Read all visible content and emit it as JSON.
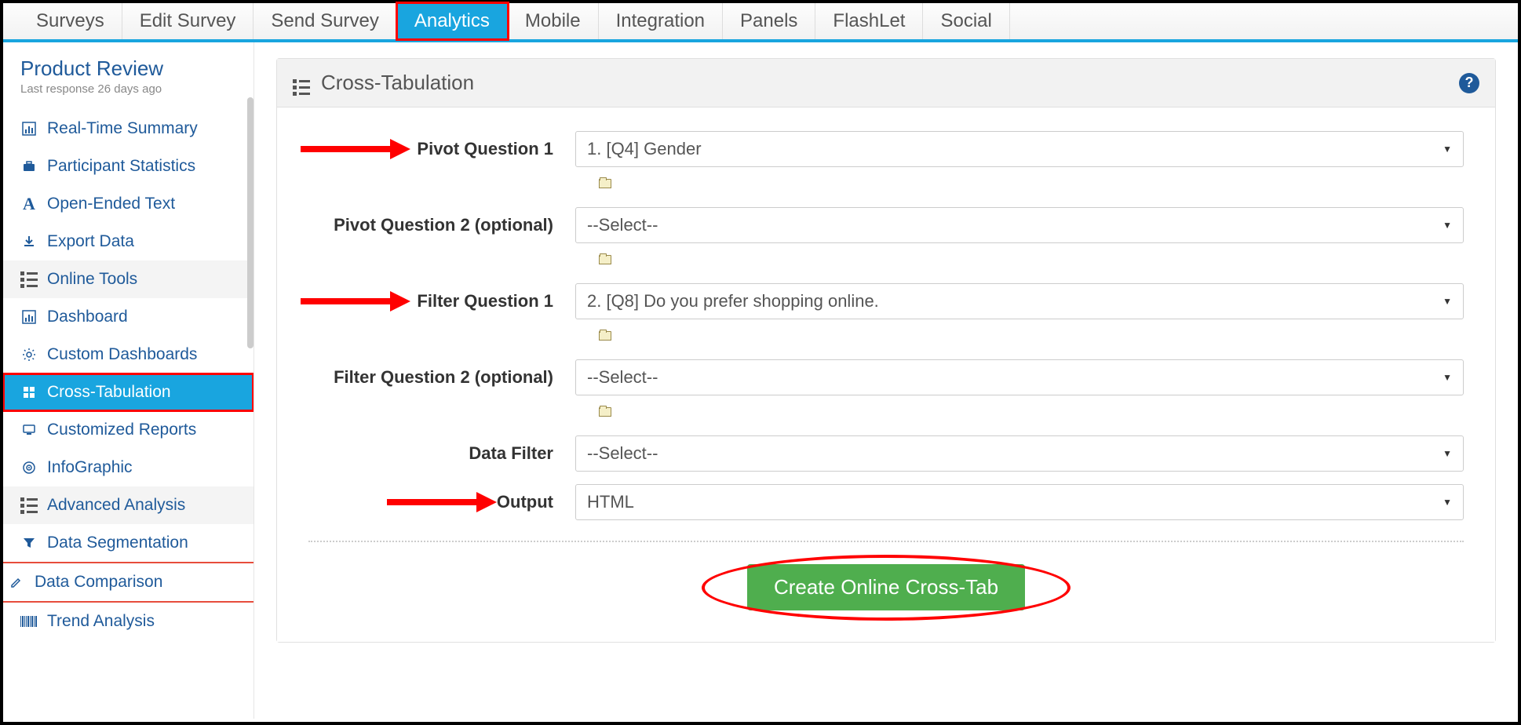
{
  "tabs": {
    "items": [
      {
        "label": "Surveys"
      },
      {
        "label": "Edit Survey"
      },
      {
        "label": "Send Survey"
      },
      {
        "label": "Analytics"
      },
      {
        "label": "Mobile"
      },
      {
        "label": "Integration"
      },
      {
        "label": "Panels"
      },
      {
        "label": "FlashLet"
      },
      {
        "label": "Social"
      }
    ],
    "active_index": 3
  },
  "sidebar": {
    "survey_name": "Product Review",
    "survey_sub": "Last response 26 days ago",
    "items": [
      {
        "icon": "chart-bar",
        "label": "Real-Time Summary"
      },
      {
        "icon": "briefcase",
        "label": "Participant Statistics"
      },
      {
        "icon": "text-a",
        "label": "Open-Ended Text"
      },
      {
        "icon": "download",
        "label": "Export Data"
      },
      {
        "icon": "list",
        "label": "Online Tools",
        "heading": true
      },
      {
        "icon": "chart-bar",
        "label": "Dashboard"
      },
      {
        "icon": "gear",
        "label": "Custom Dashboards"
      },
      {
        "icon": "grid",
        "label": "Cross-Tabulation",
        "active": true,
        "highlight": true
      },
      {
        "icon": "monitor",
        "label": "Customized Reports"
      },
      {
        "icon": "target",
        "label": "InfoGraphic"
      },
      {
        "icon": "list",
        "label": "Advanced Analysis",
        "heading": true
      },
      {
        "icon": "funnel",
        "label": "Data Segmentation"
      },
      {
        "icon": "edit",
        "label": "Data Comparison",
        "red": true
      },
      {
        "icon": "barcode",
        "label": "Trend Analysis",
        "red": true
      }
    ]
  },
  "panel": {
    "title": "Cross-Tabulation",
    "help": "?",
    "rows": [
      {
        "label": "Pivot Question 1",
        "value": "1. [Q4] Gender",
        "folder": true,
        "arrow": true
      },
      {
        "label": "Pivot Question 2 (optional)",
        "value": "--Select--",
        "folder": true
      },
      {
        "label": "Filter Question 1",
        "value": "2. [Q8] Do you prefer shopping online.",
        "folder": true,
        "arrow": true
      },
      {
        "label": "Filter Question 2 (optional)",
        "value": "--Select--",
        "folder": true
      },
      {
        "label": "Data Filter",
        "value": "--Select--"
      },
      {
        "label": "Output",
        "value": "HTML",
        "arrow": true
      }
    ],
    "submit": "Create Online Cross-Tab"
  }
}
